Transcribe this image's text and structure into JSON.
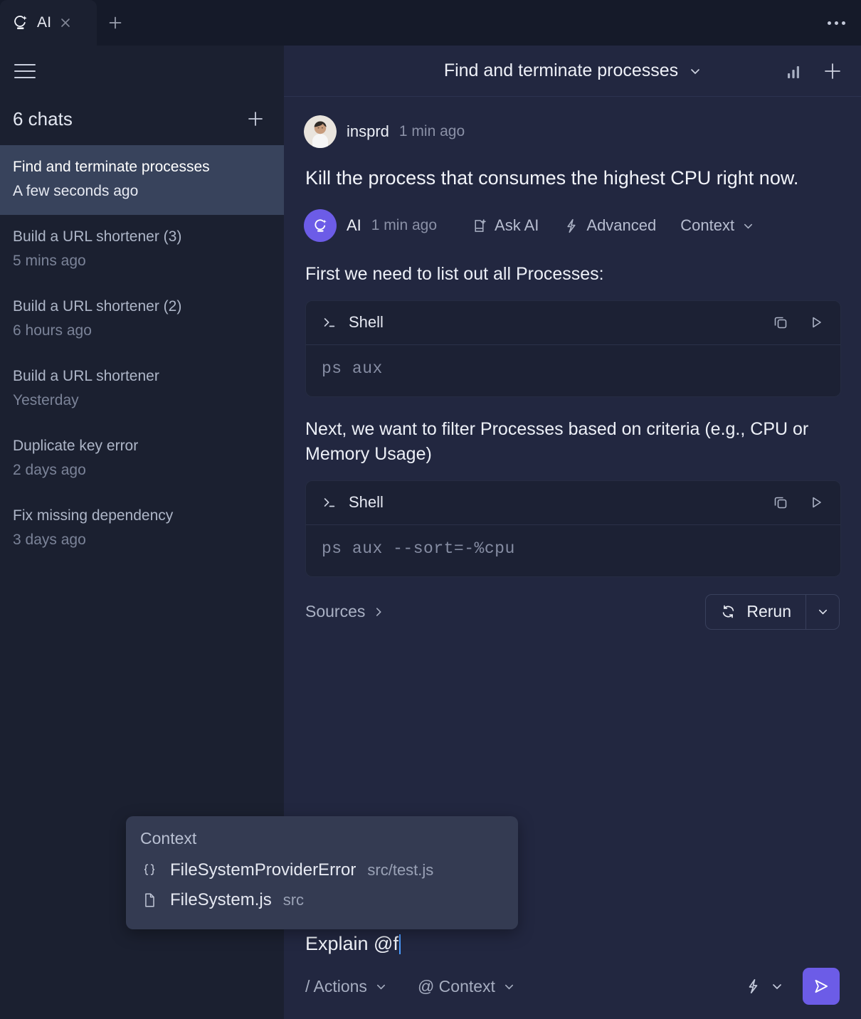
{
  "window": {
    "tab_label": "AI",
    "tab_logo_icon": "ai-moon-sparkle-logo",
    "close_icon": "close-icon",
    "new_tab_icon": "plus-icon",
    "overflow_icon": "more-horizontal-icon"
  },
  "sidebar": {
    "menu_icon": "hamburger-icon",
    "chats_count_label": "6 chats",
    "new_chat_icon": "plus-icon",
    "items": [
      {
        "title": "Find and terminate processes",
        "time": "A few seconds ago",
        "active": true
      },
      {
        "title": "Build a URL shortener (3)",
        "time": "5 mins ago",
        "active": false
      },
      {
        "title": "Build a URL shortener (2)",
        "time": "6 hours ago",
        "active": false
      },
      {
        "title": "Build a URL shortener",
        "time": "Yesterday",
        "active": false
      },
      {
        "title": "Duplicate key error",
        "time": "2 days ago",
        "active": false
      },
      {
        "title": "Fix missing dependency",
        "time": "3 days ago",
        "active": false
      }
    ]
  },
  "header": {
    "thread_title": "Find and terminate processes",
    "caret_icon": "chevron-down-icon",
    "stats_icon": "bar-chart-icon",
    "add_icon": "plus-icon"
  },
  "conversation": {
    "user_message": {
      "avatar_icon": "user-avatar",
      "author": "insprd",
      "time": "1 min ago",
      "text": "Kill the process that consumes the highest CPU right now."
    },
    "ai_message": {
      "avatar_icon": "ai-moon-sparkle-logo",
      "author": "AI",
      "time": "1 min ago",
      "actions": [
        {
          "label": "Ask AI",
          "icon": "page-plus-icon"
        },
        {
          "label": "Advanced",
          "icon": "bolt-icon"
        },
        {
          "label": "Context",
          "icon": "chevron-down-icon"
        }
      ],
      "paragraph_1": "First we need to list out all Processes:",
      "code_block_1": {
        "prompt_icon": "terminal-prompt-icon",
        "language": "Shell",
        "copy_icon": "copy-icon",
        "run_icon": "play-icon",
        "code": "ps aux"
      },
      "paragraph_2": "Next, we want to filter Processes based on criteria (e.g., CPU or Memory Usage)",
      "code_block_2": {
        "prompt_icon": "terminal-prompt-icon",
        "language": "Shell",
        "copy_icon": "copy-icon",
        "run_icon": "play-icon",
        "code": "ps aux --sort=-%cpu"
      },
      "sources_label": "Sources",
      "sources_icon": "chevron-right-icon",
      "rerun_label": "Rerun",
      "rerun_icon": "refresh-icon",
      "rerun_caret_icon": "chevron-down-icon"
    }
  },
  "context_popup": {
    "title": "Context",
    "items": [
      {
        "icon": "braces-icon",
        "name": "FileSystemProviderError",
        "path": "src/test.js"
      },
      {
        "icon": "file-icon",
        "name": "FileSystem.js",
        "path": "src"
      }
    ]
  },
  "composer": {
    "input_value": "Explain @f",
    "actions_label": "/ Actions",
    "actions_caret_icon": "chevron-down-icon",
    "context_label": "@ Context",
    "context_caret_icon": "chevron-down-icon",
    "model_icon": "bolt-icon",
    "model_caret_icon": "chevron-down-icon",
    "send_icon": "send-icon"
  },
  "colors": {
    "accent": "#6c5ce7",
    "sidebar_bg": "#1b2030",
    "main_bg": "#222740",
    "code_bg": "#1c2134",
    "active_item_bg": "#38435c",
    "popup_bg": "#343b52",
    "caret": "#4a9bff"
  }
}
